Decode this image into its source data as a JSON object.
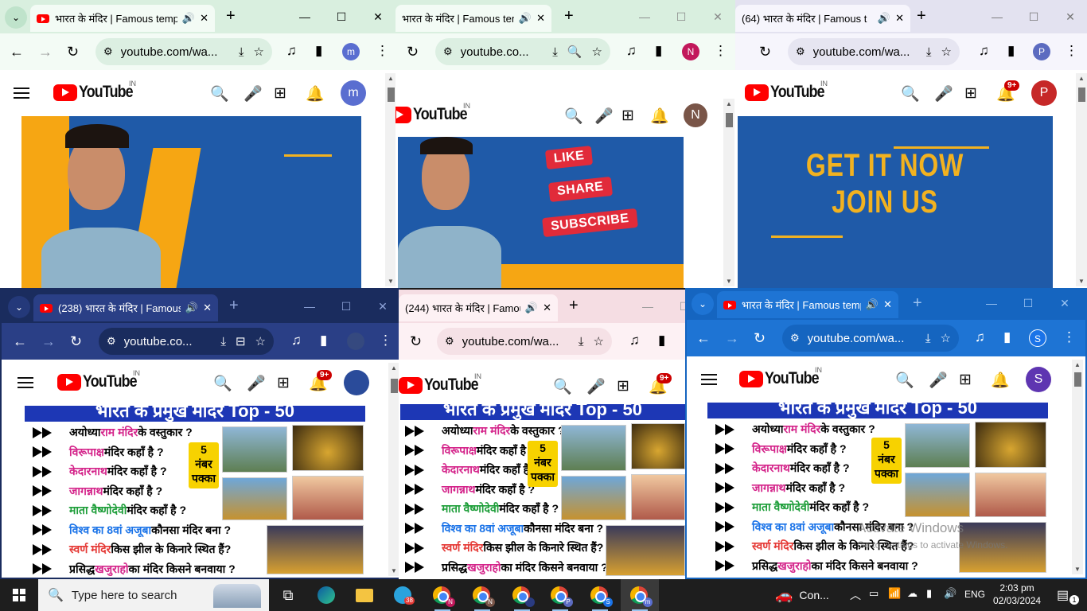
{
  "windows": [
    {
      "id": "w1",
      "tab_title": "भारत के मंदिर | Famous temp",
      "url": "youtube.com/wa...",
      "profile": "m",
      "profile_color": "#5a6ed0",
      "theme": "light-green"
    },
    {
      "id": "w2",
      "tab_title": "भारत के मंदिर | Famous temp",
      "url": "youtube.co...",
      "profile": "N",
      "profile_color": "#c2185b",
      "theme": "light-green"
    },
    {
      "id": "w3",
      "tab_title": "(64) भारत के मंदिर | Famous t",
      "url": "youtube.com/wa...",
      "profile": "P",
      "profile_color": "#5c6bc0",
      "theme": "light-lavender"
    },
    {
      "id": "w4",
      "tab_title": "(238) भारत के मंदिर | Famous",
      "url": "youtube.co...",
      "profile": "",
      "profile_color": "#2a3b80",
      "theme": "navy"
    },
    {
      "id": "w5",
      "tab_title": "(244) भारत के मंदिर | Famous",
      "url": "youtube.com/wa...",
      "profile": "",
      "profile_color": "#888",
      "theme": "pink"
    },
    {
      "id": "w6",
      "tab_title": "भारत के मंदिर | Famous temp",
      "url": "youtube.com/wa...",
      "profile": "S",
      "profile_color": "#1a73e8",
      "theme": "blue"
    }
  ],
  "youtube": {
    "logo_text": "YouTube",
    "country_code": "IN",
    "notif_badge": "9+",
    "avatars": {
      "w1": "m",
      "w2": "N",
      "w3": "P",
      "w6": "S"
    },
    "avatar_colors": {
      "w1": "#5a6ed0",
      "w2": "#795548",
      "w3": "#c62828",
      "w6": "#5e35b1"
    }
  },
  "promo": {
    "pills": [
      "LIKE",
      "SHARE",
      "SUBSCRIBE"
    ],
    "cta_line1": "GET IT NOW",
    "cta_line2": "JOIN US"
  },
  "temple_list": {
    "header": "भारत के प्रमुख मंदिर Top - 50",
    "rows": [
      {
        "pre": "अयोध्या ",
        "hl": "राम मंदिर",
        "post": " के वस्तुकार ?",
        "hl_color": "#d4248a"
      },
      {
        "pre": "",
        "hl": "विरूपाक्ष",
        "post": " मंदिर कहाँ है ?",
        "hl_color": "#d4248a"
      },
      {
        "pre": "",
        "hl": "केदारनाथ",
        "post": " मंदिर कहाँ है ?",
        "hl_color": "#d4248a"
      },
      {
        "pre": "",
        "hl": "जागन्नाथ",
        "post": " मंदिर कहाँ है ?",
        "hl_color": "#d4248a"
      },
      {
        "pre": "",
        "hl": "माता वैष्णोदेवी",
        "post": " मंदिर कहाँ है ?",
        "hl_color": "#1e9e3a"
      },
      {
        "pre": "",
        "hl": "विश्व का 8वां अजूबा",
        "post": " कौनसा मंदिर बना ?",
        "hl_color": "#1a73e8"
      },
      {
        "pre": "",
        "hl": "स्वर्ण मंदिर",
        "post": " किस झील के किनारे स्थित हैं?",
        "hl_color": "#e53935"
      },
      {
        "pre": "प्रसिद्ध ",
        "hl": "खजुराहो",
        "post": " का मंदिर किसने बनवाया ?",
        "hl_color": "#d4248a"
      }
    ],
    "badge_line1": "5",
    "badge_line2": "नंबर",
    "badge_line3": "पक्का"
  },
  "watermark": {
    "line1": "Activate Windows",
    "line2": "Go to Settings to activate Windows."
  },
  "taskbar": {
    "search_placeholder": "Type here to search",
    "telegram_badge": "38",
    "weather_text": "Con...",
    "lang": "ENG",
    "time": "2:03 pm",
    "date": "02/03/2024",
    "notif_count": "1",
    "chrome_profiles": [
      "N",
      "N",
      "",
      "P",
      "S",
      "m"
    ]
  },
  "colors": {
    "yt_red": "#ff0000",
    "taskbar": "#1e1e1e",
    "promo_blue": "#1f5aa8",
    "promo_yellow": "#f6a613"
  }
}
